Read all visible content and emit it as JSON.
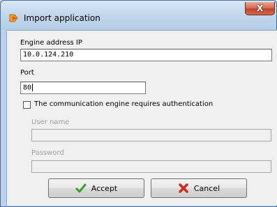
{
  "window": {
    "title": "Import application",
    "close_glyph": "X"
  },
  "form": {
    "engine_label": "Engine address IP",
    "engine_value": "10.0.124.210",
    "port_label": "Port",
    "port_value": "80",
    "auth_checkbox_label": "The communication engine requires authentication",
    "auth_checked": false,
    "username_label": "User name",
    "username_value": "",
    "password_label": "Password",
    "password_value": ""
  },
  "buttons": {
    "accept_label": "Accept",
    "cancel_label": "Cancel"
  },
  "icons": {
    "app_icon": "import-app-icon",
    "accept_icon": "green-check-icon",
    "cancel_icon": "red-x-icon"
  },
  "colors": {
    "title_bar": "#c2d7ec",
    "close_button": "#c0442a",
    "client_bg": "#f0f0f0",
    "accept_icon": "#3a9d23",
    "cancel_icon": "#d02a1c"
  }
}
